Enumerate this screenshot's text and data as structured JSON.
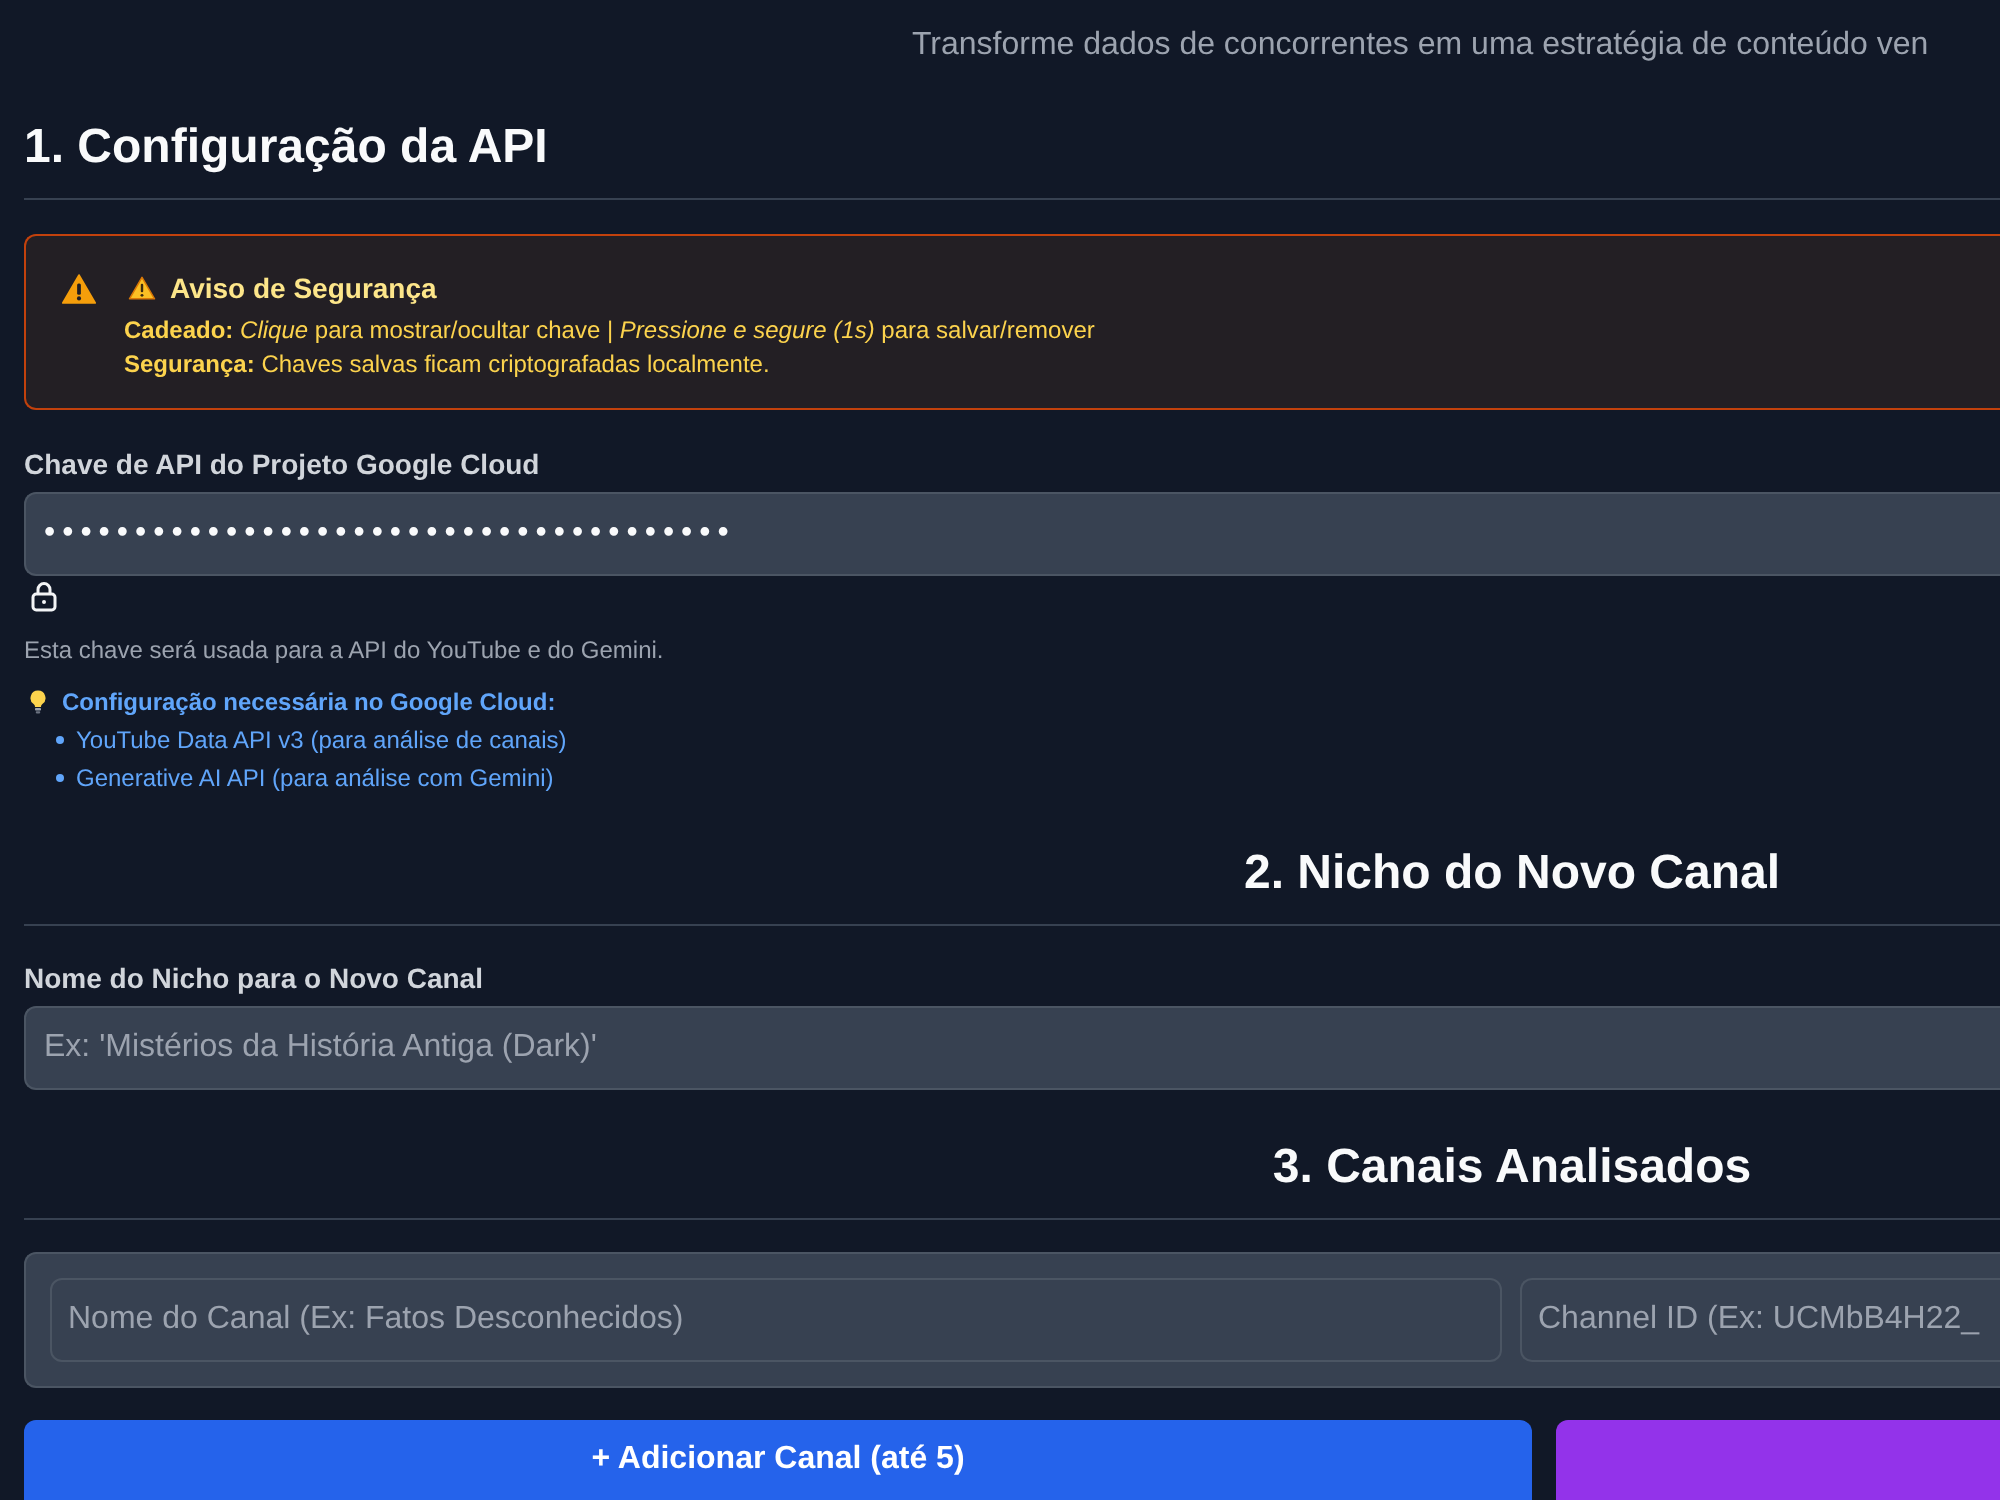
{
  "subtitle": "Transforme dados de concorrentes em uma estratégia de conteúdo ven",
  "api_section": {
    "title": "1. Configuração da API",
    "alert": {
      "title": "Aviso de Segurança",
      "lines": [
        "**Cadeado:** *Clique* para mostrar/ocultar chave | *Pressione e segure (1s)* para salvar/remover",
        "**Segurança:** Chaves salvas ficam criptografadas localmente."
      ]
    },
    "key_field": {
      "label": "Chave de API do Projeto Google Cloud",
      "value": "••••••••••••••••••••••••••••••••••••••"
    },
    "help": "Esta chave será usada para a API do YouTube e do Gemini.",
    "setup": {
      "title": "Configuração necessária no Google Cloud:",
      "items": [
        "YouTube Data API v3 (para análise de canais)",
        "Generative AI API (para análise com Gemini)"
      ]
    }
  },
  "niche_section": {
    "title": "2. Nicho do Novo Canal",
    "field": {
      "label": "Nome do Nicho para o Novo Canal",
      "placeholder": "Ex: 'Mistérios da História Antiga (Dark)'"
    }
  },
  "channels_section": {
    "title": "3. Canais Analisados",
    "rows": [
      {
        "name_placeholder": "Nome do Canal (Ex: Fatos Desconhecidos)",
        "id_placeholder": "Channel ID (Ex: UCMbB4H22_"
      }
    ],
    "buttons": [
      {
        "kind": "add",
        "label": "+ Adicionar Canal (até 5)"
      },
      {
        "kind": "accent"
      }
    ]
  }
}
